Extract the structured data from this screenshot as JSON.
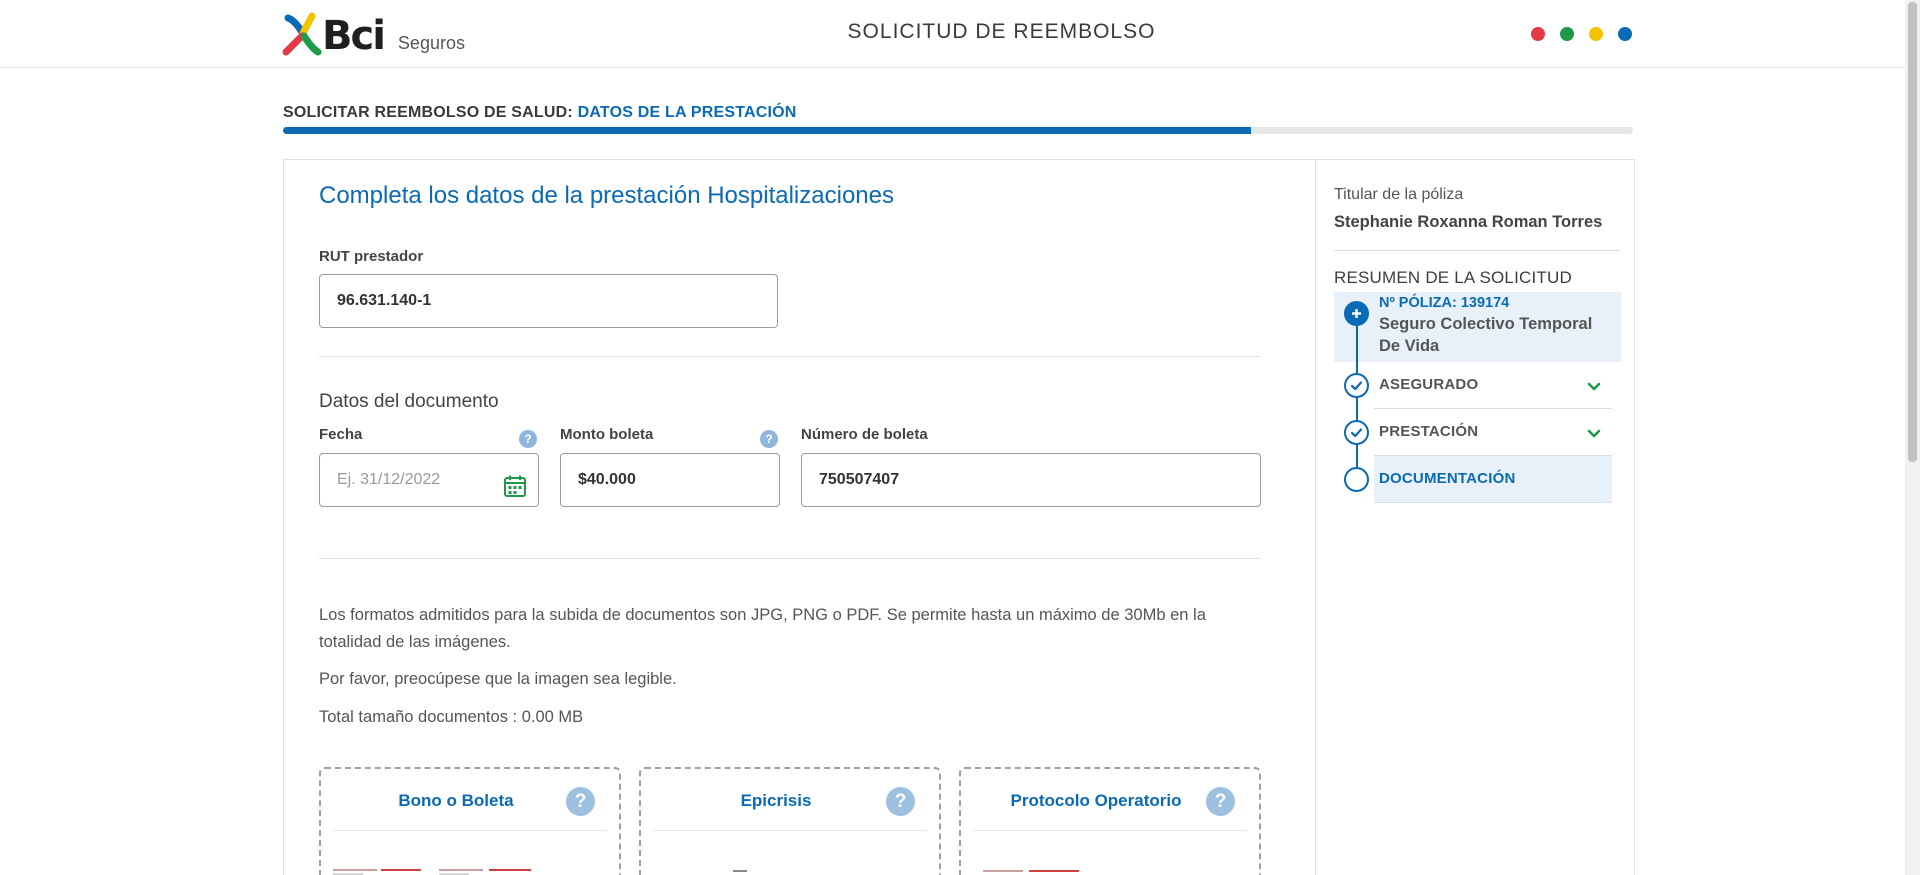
{
  "header": {
    "logo_text": "Bci",
    "logo_sub": "Seguros",
    "title": "SOLICITUD DE REEMBOLSO",
    "dots": [
      "#e63946",
      "#1e9a48",
      "#f4c400",
      "#0a6ab6"
    ]
  },
  "step": {
    "prefix": "SOLICITAR REEMBOLSO DE SALUD:",
    "current": "DATOS DE LA PRESTACIÓN",
    "progress_percent": 71.7
  },
  "form": {
    "heading": "Completa los datos de la prestación Hospitalizaciones",
    "rut": {
      "label": "RUT prestador",
      "value": "96.631.140-1"
    },
    "doc_section": "Datos del documento",
    "fecha": {
      "label": "Fecha",
      "placeholder": "Ej. 31/12/2022",
      "help": "?"
    },
    "monto": {
      "label": "Monto boleta",
      "value": "$40.000",
      "help": "?"
    },
    "numero": {
      "label": "Número de boleta",
      "value": "750507407"
    }
  },
  "info": {
    "formats": "Los formatos admitidos para la subida de documentos son JPG, PNG o PDF. Se permite hasta un máximo de 30Mb en la totalidad de las imágenes.",
    "legible": "Por favor, preocúpese que la imagen sea legible.",
    "total": "Total tamaño documentos : 0.00 MB"
  },
  "uploads": [
    {
      "title": "Bono o Boleta",
      "help": "?"
    },
    {
      "title": "Epicrisis",
      "help": "?"
    },
    {
      "title": "Protocolo Operatorio",
      "help": "?"
    }
  ],
  "sidebar": {
    "holder_label": "Titular de la póliza",
    "holder_name": "Stephanie Roxanna Roman Torres",
    "summary_heading": "RESUMEN DE LA SOLICITUD",
    "policy_number": "Nº PÓLIZA: 139174",
    "policy_name": "Seguro Colectivo Temporal De Vida",
    "steps": [
      "ASEGURADO",
      "PRESTACIÓN",
      "DOCUMENTACIÓN"
    ]
  }
}
